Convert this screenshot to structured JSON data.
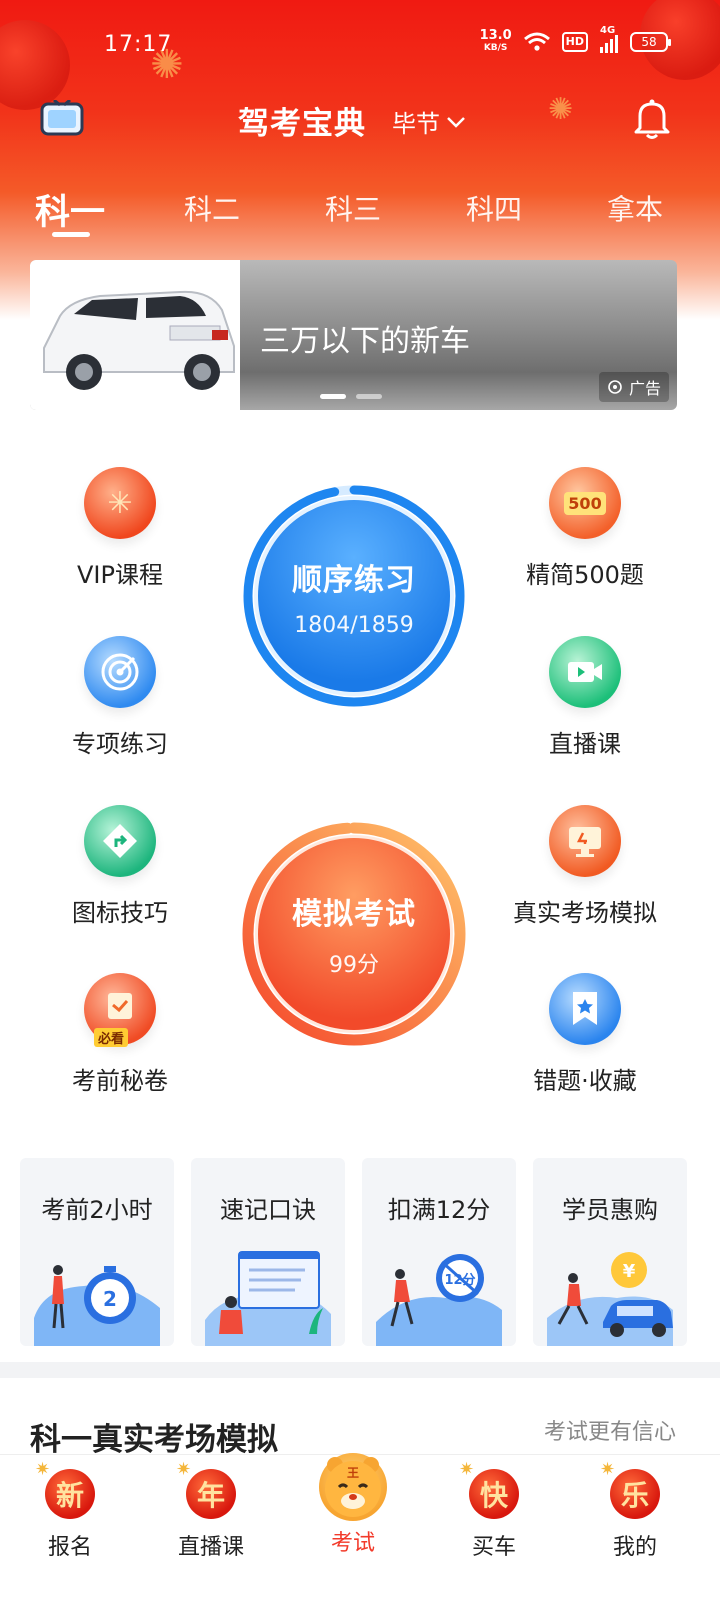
{
  "status_bar": {
    "time": "17:17",
    "net_speed": "13.0",
    "net_unit": "KB/S",
    "hd": "HD",
    "signal": "4G",
    "battery": "58"
  },
  "header": {
    "title": "驾考宝典",
    "city": "毕节"
  },
  "subject_tabs": [
    "科一",
    "科二",
    "科三",
    "科四",
    "拿本"
  ],
  "active_tab": 0,
  "banner": {
    "text": "三万以下的新车",
    "ad_label": "广告",
    "active_dot": 0,
    "dot_count": 2
  },
  "features": {
    "left": [
      "VIP课程",
      "专项练习",
      "图标技巧",
      "考前秘卷"
    ],
    "right": [
      "精简500题",
      "直播课",
      "真实考场模拟",
      "错题·收藏"
    ]
  },
  "icon_labels": {
    "jingjian": "500",
    "bikan": "必看"
  },
  "sequential_practice": {
    "title": "顺序练习",
    "done": 1804,
    "total": 1859,
    "progress_text": "1804/1859"
  },
  "mock_exam": {
    "title": "模拟考试",
    "score_text": "99分",
    "score": 99
  },
  "cards": [
    {
      "title": "考前2小时",
      "art_text": "2"
    },
    {
      "title": "速记口诀"
    },
    {
      "title": "扣满12分",
      "art_text": "12分"
    },
    {
      "title": "学员惠购",
      "art_text": "¥"
    }
  ],
  "section": {
    "title": "科一真实考场模拟",
    "subtitle": "考试更有信心"
  },
  "bottom_nav": [
    {
      "label": "报名",
      "glyph": "新"
    },
    {
      "label": "直播课",
      "glyph": "年"
    },
    {
      "label": "考试",
      "glyph": "王"
    },
    {
      "label": "买车",
      "glyph": "快"
    },
    {
      "label": "我的",
      "glyph": "乐"
    }
  ],
  "colors": {
    "header_red": "#f01a12",
    "blue_ring": "#1e86f0",
    "orange_ring": "#f35a33",
    "nav_active": "#f23a2a"
  }
}
